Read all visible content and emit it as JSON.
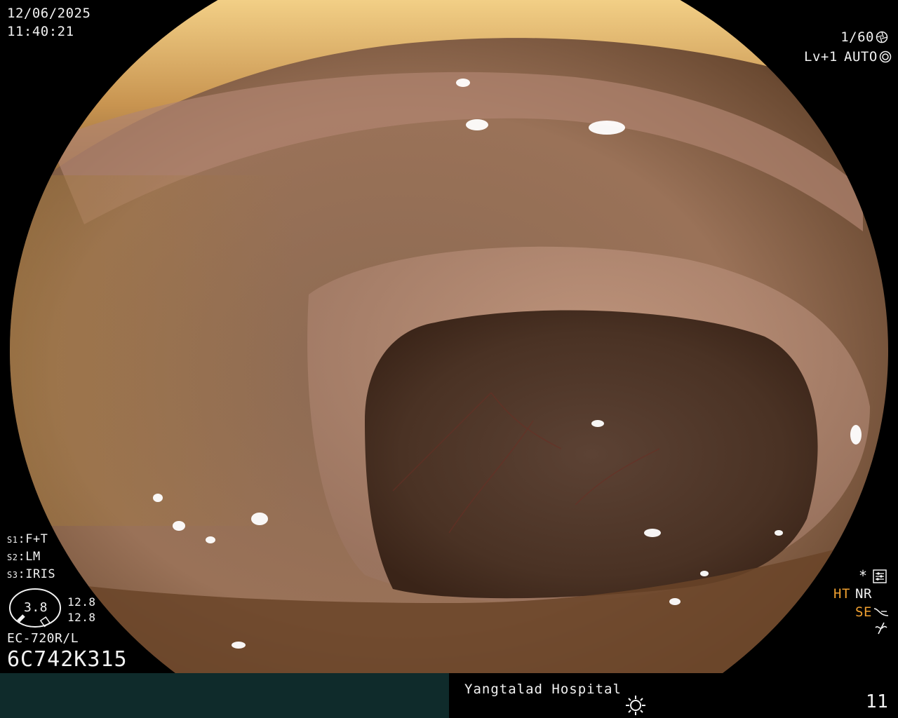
{
  "overlay": {
    "date": "12/06/2025",
    "time": "11:40:21",
    "shutter": "1/60",
    "level": "Lv+1",
    "auto": "AUTO",
    "settings": [
      {
        "key": "S1",
        "value": "F+T"
      },
      {
        "key": "S2",
        "value": "LM"
      },
      {
        "key": "S3",
        "value": "IRIS"
      }
    ],
    "gauge": {
      "center": "3.8",
      "top": "12.8",
      "bottom": "12.8"
    },
    "model": "EC-720R/L",
    "serial": "6C742K315",
    "right_flags": {
      "ht": "HT",
      "nr": "NR",
      "se": "SE",
      "star": "*"
    }
  },
  "footer": {
    "hospital": "Yangtalad Hospital",
    "image_count": "11"
  },
  "colors": {
    "footer_left": "#0f2b2b",
    "accent_orange": "#f0a030",
    "overlay_text": "#f2f2f2"
  },
  "icons": [
    "shutter-icon",
    "auto-icon",
    "settings-icon",
    "dial-icon",
    "no-signal-icon",
    "brightness-icon"
  ]
}
